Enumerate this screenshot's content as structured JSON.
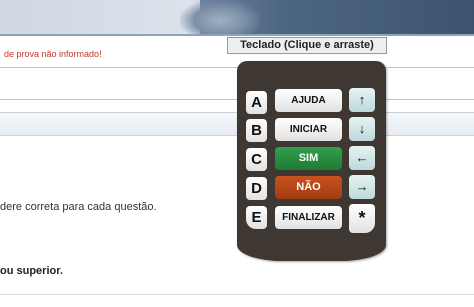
{
  "header": {
    "error_text": "de prova não informado!"
  },
  "content": {
    "instruction_text": "dere correta para cada questão.",
    "superior_text": "ou superior."
  },
  "keyboard": {
    "title": "Teclado (Clique e arraste)",
    "letters": [
      "A",
      "B",
      "C",
      "D",
      "E"
    ],
    "actions": [
      "AJUDA",
      "INICIAR",
      "SIM",
      "NÃO",
      "FINALIZAR"
    ],
    "arrows": [
      {
        "glyph": "↑",
        "icon": "arrow-up-icon"
      },
      {
        "glyph": "↓",
        "icon": "arrow-down-icon"
      },
      {
        "glyph": "←",
        "icon": "arrow-left-icon"
      },
      {
        "glyph": "→",
        "icon": "arrow-right-icon"
      }
    ],
    "star": "*",
    "colors": {
      "body": "#3f3732",
      "sim": "#2a8c40",
      "nao": "#b8491a",
      "arrow": "#cfe5e6"
    }
  }
}
